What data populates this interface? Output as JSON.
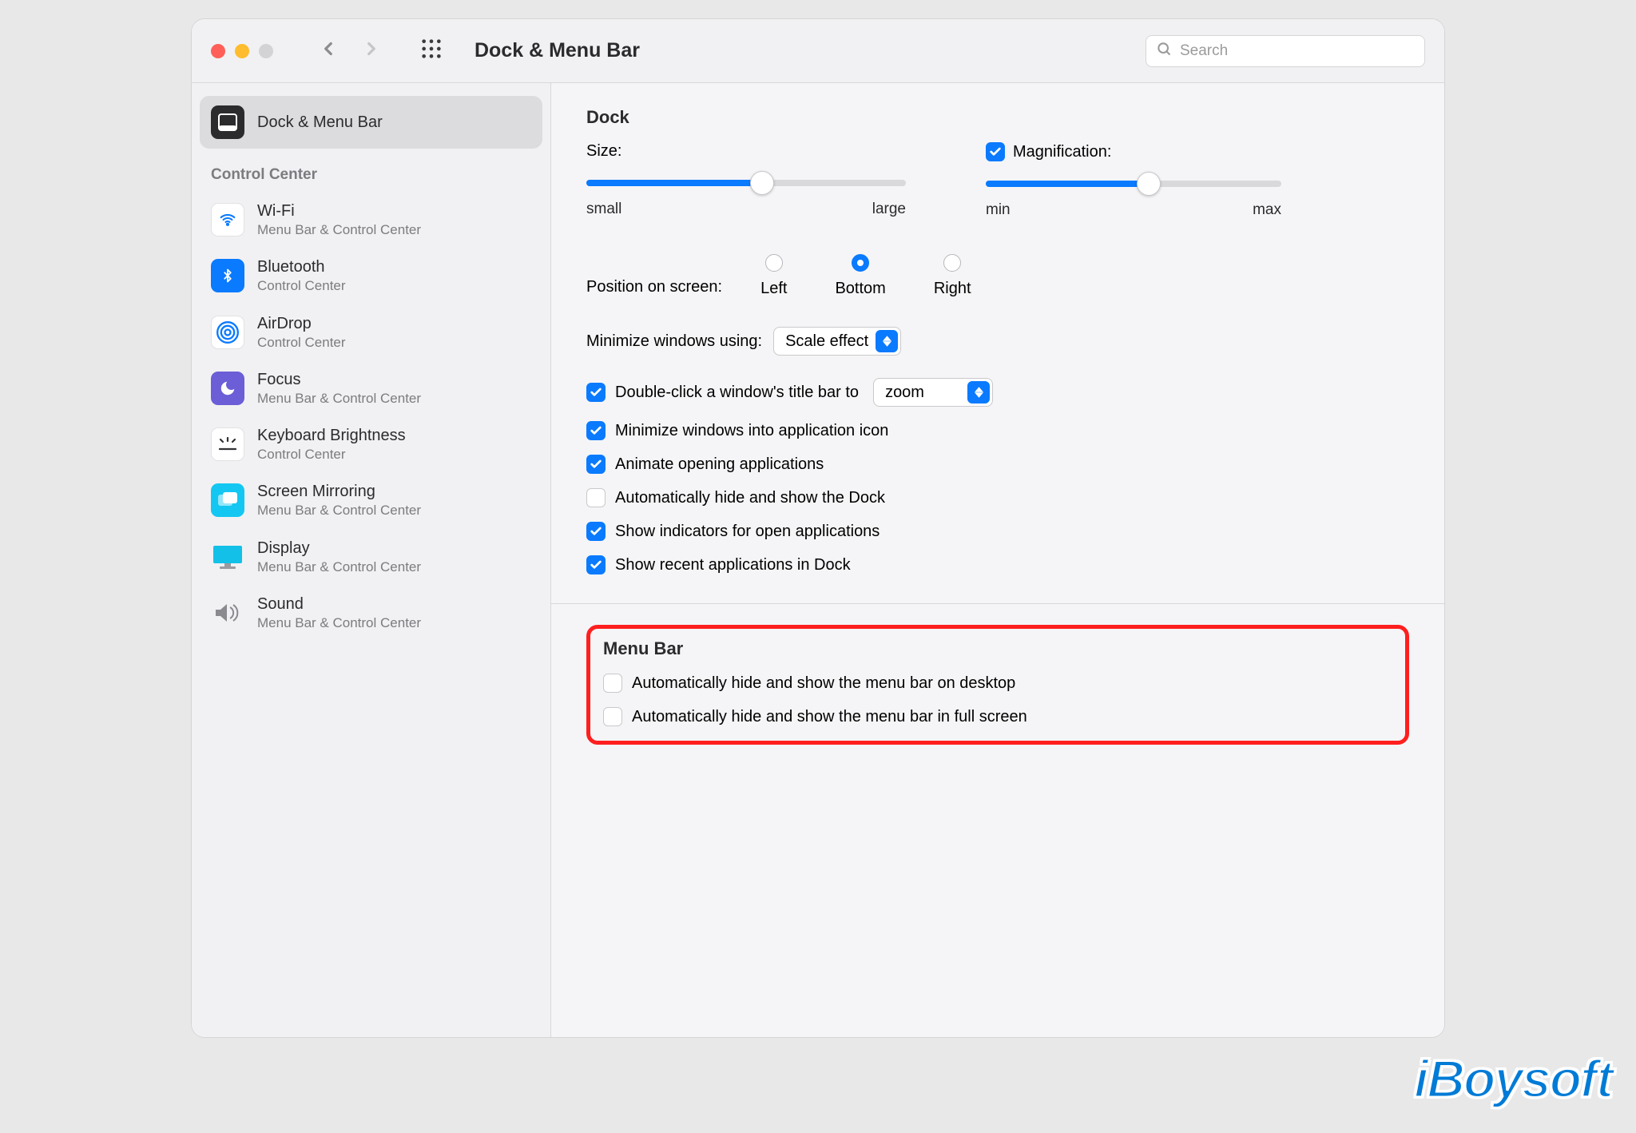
{
  "header": {
    "title": "Dock & Menu Bar",
    "search_placeholder": "Search"
  },
  "sidebar": {
    "top_item": {
      "label": "Dock & Menu Bar"
    },
    "section_label": "Control Center",
    "items": [
      {
        "label": "Wi-Fi",
        "sub": "Menu Bar & Control Center"
      },
      {
        "label": "Bluetooth",
        "sub": "Control Center"
      },
      {
        "label": "AirDrop",
        "sub": "Control Center"
      },
      {
        "label": "Focus",
        "sub": "Menu Bar & Control Center"
      },
      {
        "label": "Keyboard Brightness",
        "sub": "Control Center"
      },
      {
        "label": "Screen Mirroring",
        "sub": "Menu Bar & Control Center"
      },
      {
        "label": "Display",
        "sub": "Menu Bar & Control Center"
      },
      {
        "label": "Sound",
        "sub": "Menu Bar & Control Center"
      }
    ]
  },
  "main": {
    "dock": {
      "heading": "Dock",
      "size_label": "Size:",
      "size_min": "small",
      "size_max": "large",
      "mag_label": "Magnification:",
      "mag_min": "min",
      "mag_max": "max",
      "position_label": "Position on screen:",
      "positions": [
        "Left",
        "Bottom",
        "Right"
      ],
      "position_selected": "Bottom",
      "minimize_label": "Minimize windows using:",
      "minimize_value": "Scale effect",
      "dblclick_label": "Double-click a window's title bar to",
      "dblclick_value": "zoom",
      "checks": [
        {
          "label": "Minimize windows into application icon",
          "checked": true
        },
        {
          "label": "Animate opening applications",
          "checked": true
        },
        {
          "label": "Automatically hide and show the Dock",
          "checked": false
        },
        {
          "label": "Show indicators for open applications",
          "checked": true
        },
        {
          "label": "Show recent applications in Dock",
          "checked": true
        }
      ]
    },
    "menubar": {
      "heading": "Menu Bar",
      "checks": [
        {
          "label": "Automatically hide and show the menu bar on desktop",
          "checked": false
        },
        {
          "label": "Automatically hide and show the menu bar in full screen",
          "checked": false
        }
      ]
    }
  },
  "watermark": "iBoysoft",
  "colors": {
    "accent": "#0a7aff"
  }
}
